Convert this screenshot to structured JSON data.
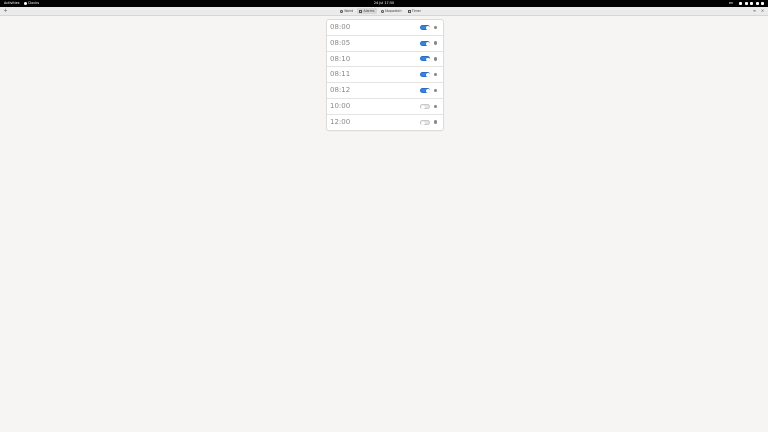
{
  "topbar": {
    "activities": "Activities",
    "app_menu": "Clocks",
    "clock": "24 Jul  17:50",
    "lang": "en"
  },
  "tabs": [
    {
      "label": "World",
      "active": false,
      "icon": "globe-icon"
    },
    {
      "label": "Alarms",
      "active": true,
      "icon": "alarm-clock-icon"
    },
    {
      "label": "Stopwatch",
      "active": false,
      "icon": "stopwatch-icon"
    },
    {
      "label": "Timer",
      "active": false,
      "icon": "timer-icon"
    }
  ],
  "alarms": [
    {
      "time": "08:00",
      "enabled": true
    },
    {
      "time": "08:05",
      "enabled": true
    },
    {
      "time": "08:10",
      "enabled": true
    },
    {
      "time": "08:11",
      "enabled": true
    },
    {
      "time": "08:12",
      "enabled": true
    },
    {
      "time": "10:00",
      "enabled": false
    },
    {
      "time": "12:00",
      "enabled": false
    }
  ],
  "colors": {
    "accent": "#3584e4",
    "topbar": "#000000",
    "background": "#f6f5f4"
  }
}
